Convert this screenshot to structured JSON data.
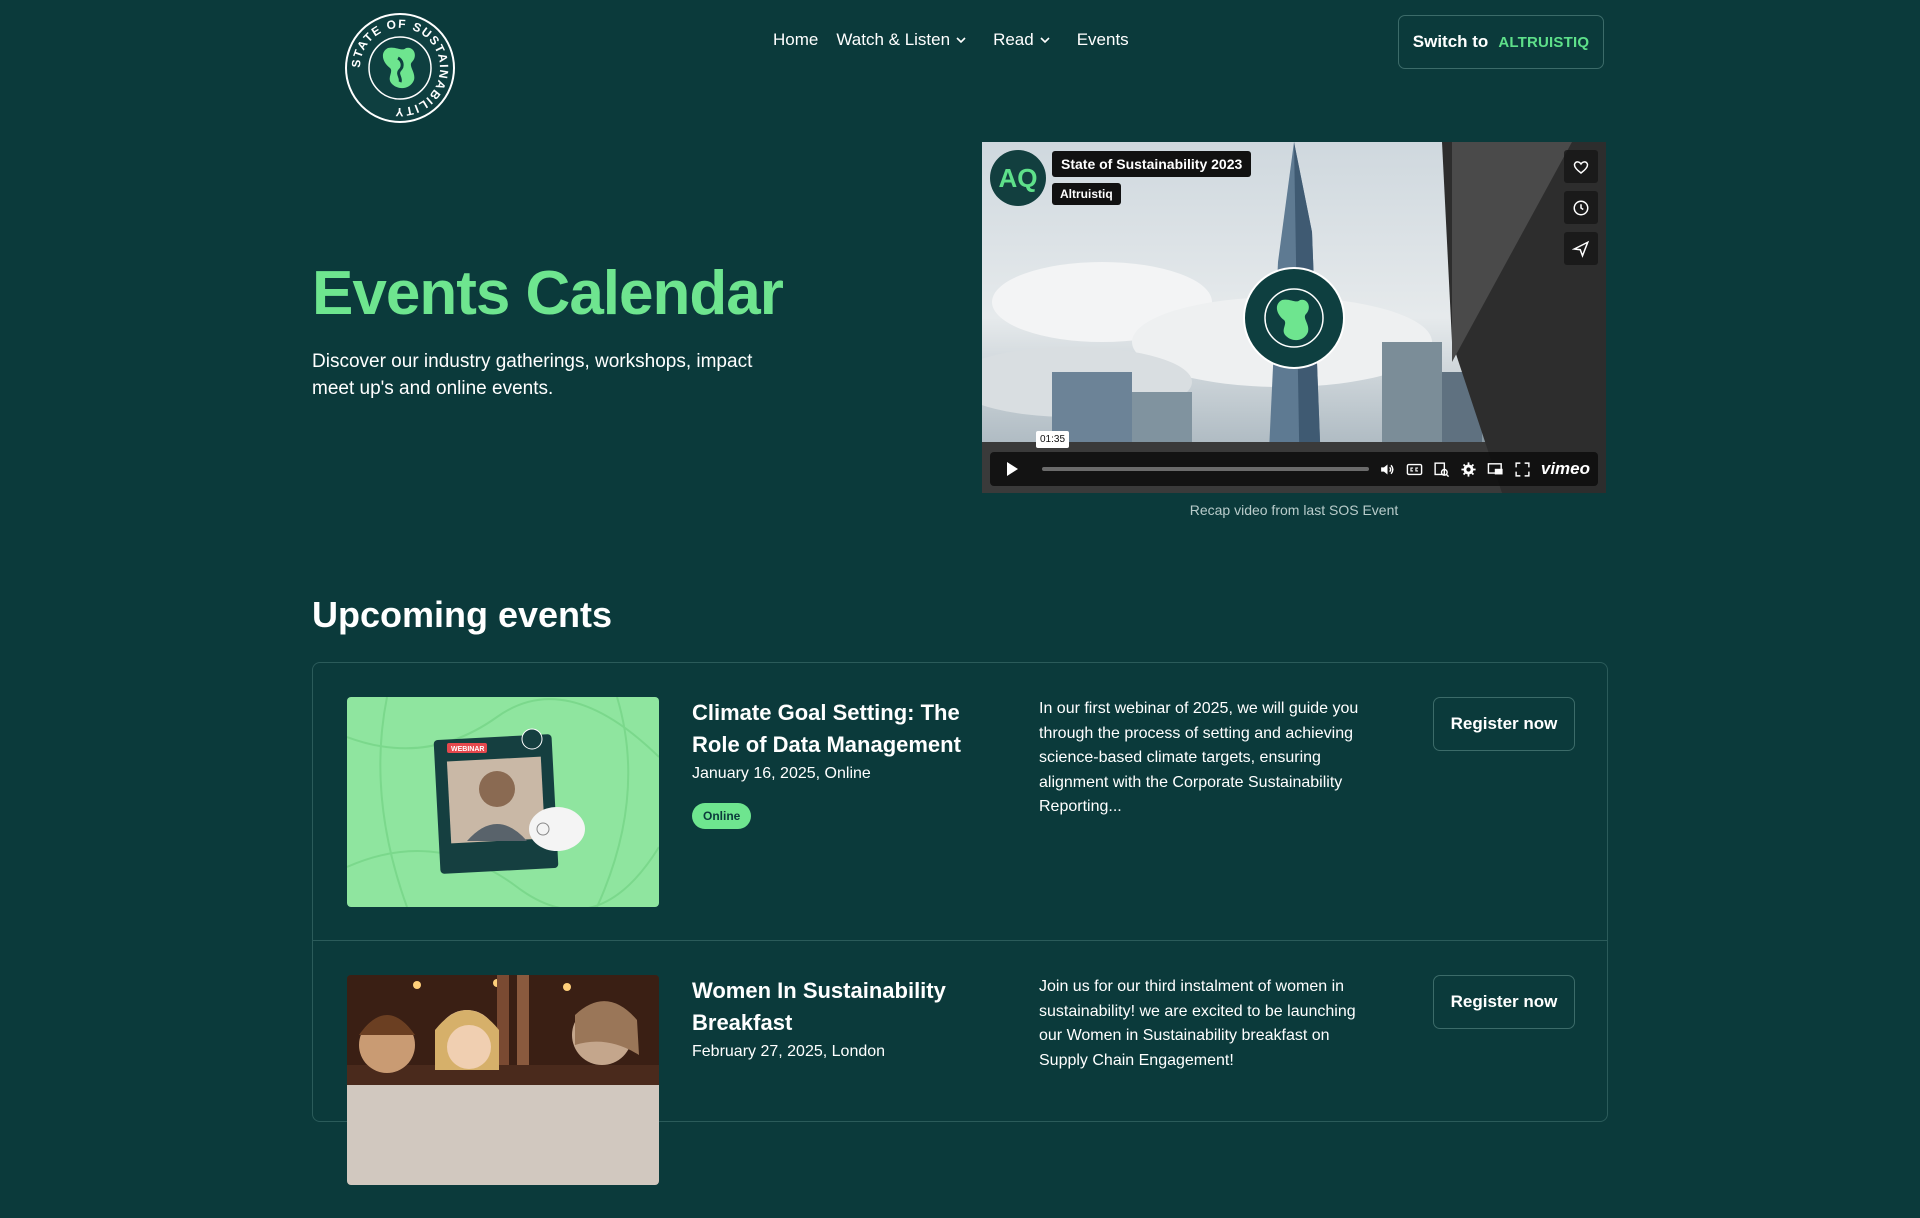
{
  "header": {
    "logo_text": "STATE OF SUSTAINABILITY",
    "nav": [
      {
        "label": "Home",
        "has_dropdown": false
      },
      {
        "label": "Watch & Listen",
        "has_dropdown": true
      },
      {
        "label": "Read",
        "has_dropdown": true
      },
      {
        "label": "Events",
        "has_dropdown": false
      }
    ],
    "switch_label": "Switch to",
    "switch_brand": "ALTRUISTIQ"
  },
  "hero": {
    "title": "Events Calendar",
    "subtitle": "Discover our industry gatherings, workshops, impact meet up's and online events."
  },
  "video": {
    "avatar": "AQ",
    "title": "State of Sustainability 2023",
    "owner": "Altruistiq",
    "time": "01:35",
    "player_brand": "vimeo",
    "caption": "Recap video from last SOS Event"
  },
  "upcoming": {
    "heading": "Upcoming events",
    "events": [
      {
        "title": "Climate Goal Setting: The Role of Data Management",
        "date": "January 16, 2025, Online",
        "badge": "Online",
        "description": "In our first webinar of 2025, we will guide you through the process of setting and achieving science-based climate targets, ensuring alignment with the Corporate Sustainability Reporting...",
        "button": "Register now",
        "thumb_tag": "WEBINAR"
      },
      {
        "title": "Women In Sustainability Breakfast",
        "date": "February 27, 2025, London",
        "description": "Join us for our third instalment of women in sustainability! we are excited to be launching our Women in Sustainability breakfast on Supply Chain Engagement!",
        "button": "Register now"
      }
    ]
  },
  "colors": {
    "background": "#0b3a3b",
    "accent": "#6ee58f",
    "border": "#2b5b5a"
  }
}
